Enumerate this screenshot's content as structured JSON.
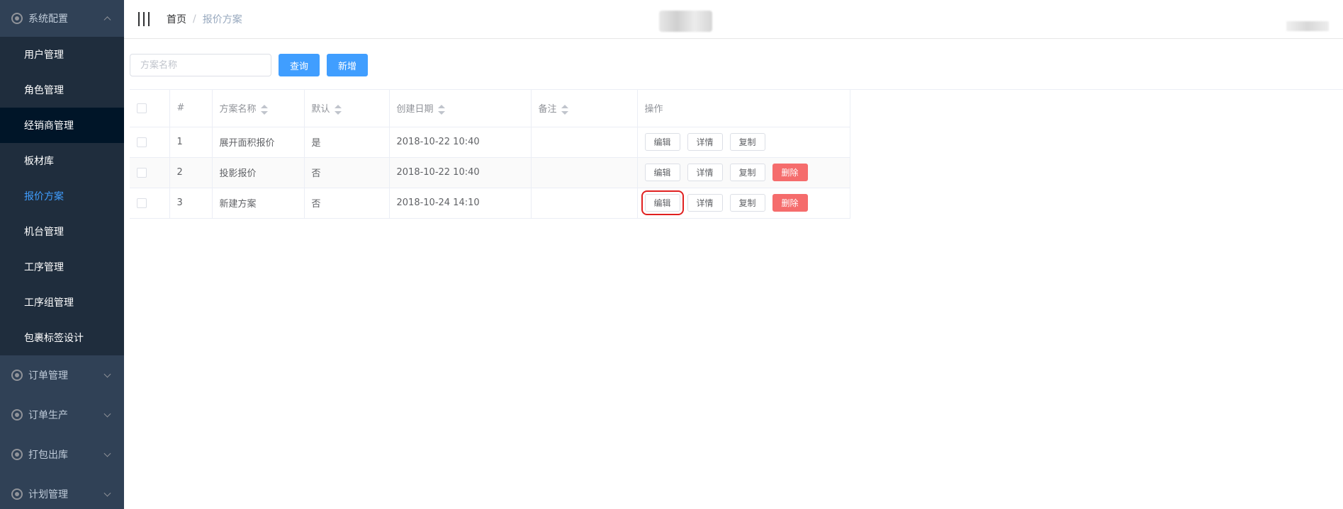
{
  "sidebar": {
    "sections": [
      {
        "label": "系统配置",
        "expanded": true
      },
      {
        "label": "订单管理",
        "expanded": false
      },
      {
        "label": "订单生产",
        "expanded": false
      },
      {
        "label": "打包出库",
        "expanded": false
      },
      {
        "label": "计划管理",
        "expanded": false
      }
    ],
    "items": [
      {
        "label": "用户管理"
      },
      {
        "label": "角色管理"
      },
      {
        "label": "经销商管理",
        "hovered": true
      },
      {
        "label": "板材库"
      },
      {
        "label": "报价方案",
        "active": true
      },
      {
        "label": "机台管理"
      },
      {
        "label": "工序管理"
      },
      {
        "label": "工序组管理"
      },
      {
        "label": "包裹标签设计"
      }
    ]
  },
  "header": {
    "breadcrumb": {
      "home": "首页",
      "separator": "/",
      "current": "报价方案"
    }
  },
  "toolbar": {
    "search_placeholder": "方案名称",
    "search_value": "",
    "query_label": "查询",
    "add_label": "新增"
  },
  "table": {
    "columns": {
      "index": "#",
      "name": "方案名称",
      "default": "默认",
      "created": "创建日期",
      "remark": "备注",
      "actions": "操作"
    },
    "actions": {
      "edit": "编辑",
      "detail": "详情",
      "copy": "复制",
      "delete": "删除"
    },
    "rows": [
      {
        "index": "1",
        "name": "展开面积报价",
        "default": "是",
        "created": "2018-10-22 10:40",
        "remark": "",
        "has_delete": false
      },
      {
        "index": "2",
        "name": "投影报价",
        "default": "否",
        "created": "2018-10-22 10:40",
        "remark": "",
        "has_delete": true
      },
      {
        "index": "3",
        "name": "新建方案",
        "default": "否",
        "created": "2018-10-24 14:10",
        "remark": "",
        "has_delete": true,
        "edit_highlighted": true
      }
    ]
  },
  "colors": {
    "sidebar_bg": "#304156",
    "submenu_bg": "#1f2d3d",
    "active": "#409eff",
    "primary": "#409eff",
    "danger": "#f56c6c",
    "highlight_box": "#e02020"
  }
}
